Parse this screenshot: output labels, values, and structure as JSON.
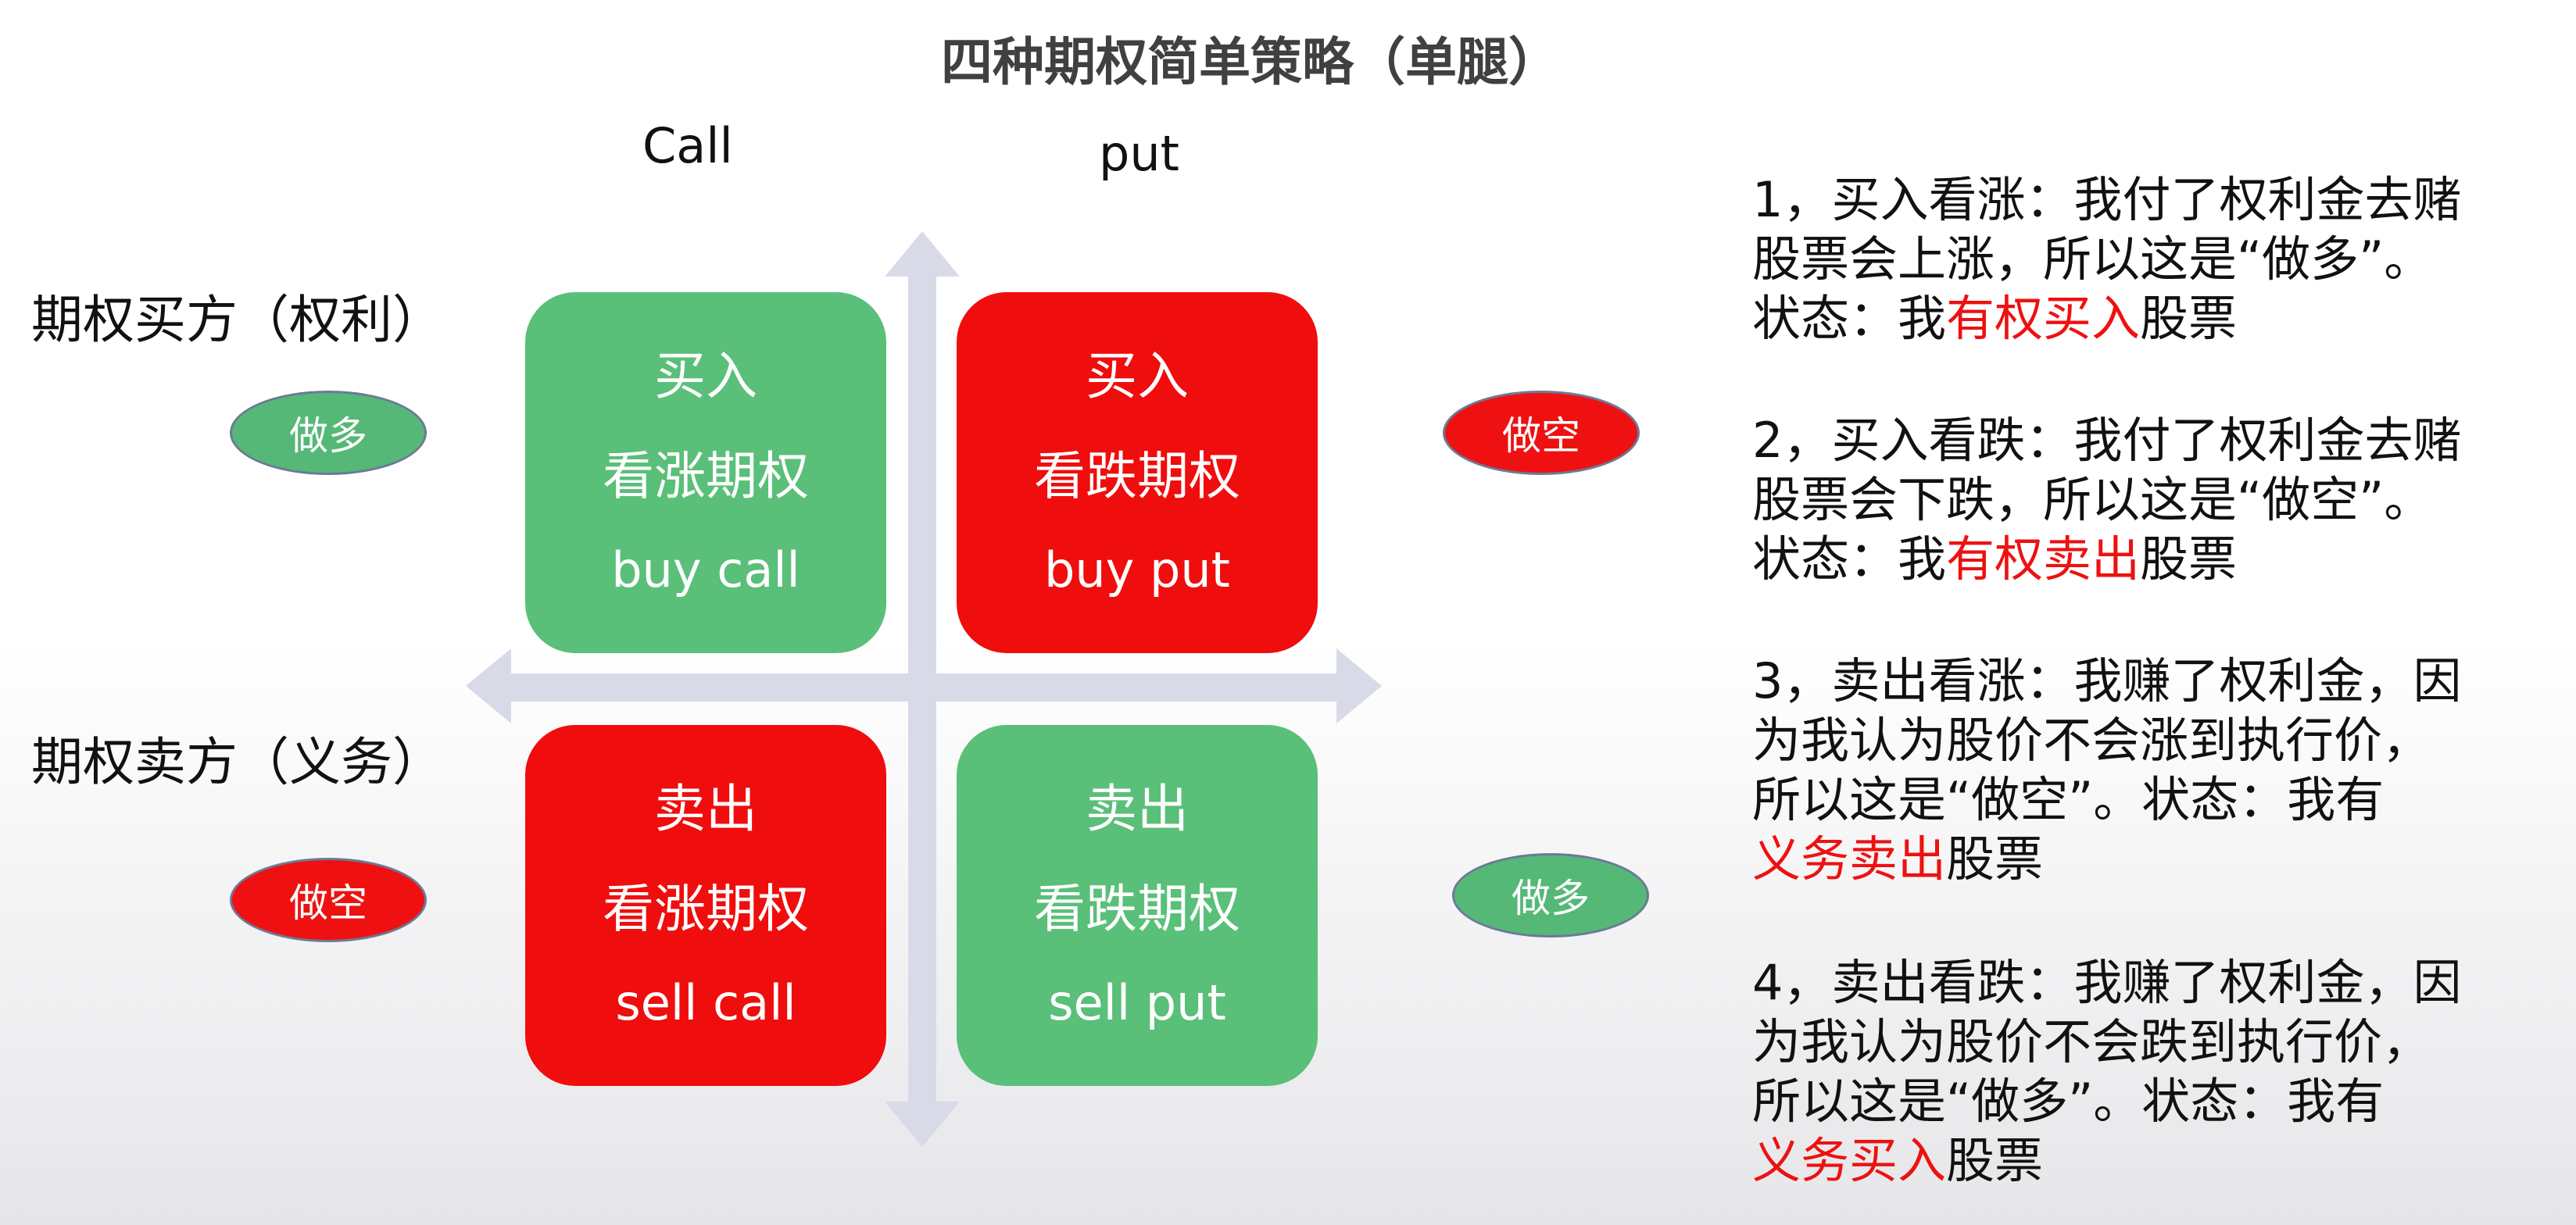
{
  "title": "四种期权简单策略（单腿）",
  "columns": {
    "call": "Call",
    "put": "put"
  },
  "rows": {
    "buyer": "期权买方（权利）",
    "seller": "期权卖方（义务）"
  },
  "tags": {
    "buyer_call": "做多",
    "buyer_put": "做空",
    "seller_call": "做空",
    "seller_put": "做多"
  },
  "quadrants": {
    "buy_call": {
      "action": "买入",
      "option": "看涨期权",
      "english": "buy call"
    },
    "buy_put": {
      "action": "买入",
      "option": "看跌期权",
      "english": "buy put"
    },
    "sell_call": {
      "action": "卖出",
      "option": "看涨期权",
      "english": "sell call"
    },
    "sell_put": {
      "action": "卖出",
      "option": "看跌期权",
      "english": "sell put"
    }
  },
  "notes": [
    {
      "lines": [
        "1，买入看涨：我付了权利金去赌",
        "股票会上涨，所以这是“做多”。"
      ],
      "state_prefix": "状态：我",
      "highlight": "有权买入",
      "suffix": "股票"
    },
    {
      "lines": [
        "2，买入看跌：我付了权利金去赌",
        "股票会下跌，所以这是“做空”。"
      ],
      "state_prefix": "状态：我",
      "highlight": "有权卖出",
      "suffix": "股票"
    },
    {
      "lines": [
        "3，卖出看涨：我赚了权利金，因",
        "为我认为股价不会涨到执行价，",
        "所以这是“做空”。状态：我有"
      ],
      "state_prefix": "",
      "highlight": "义务卖出",
      "suffix": "股票"
    },
    {
      "lines": [
        "4，卖出看跌：我赚了权利金，因",
        "为我认为股价不会跌到执行价，",
        "所以这是“做多”。状态：我有"
      ],
      "state_prefix": "",
      "highlight": "义务买入",
      "suffix": "股票"
    }
  ],
  "colors": {
    "positive": "#5abf79",
    "negative": "#f00d0d",
    "axis": "#d9dae8",
    "highlight": "#ee1111"
  }
}
